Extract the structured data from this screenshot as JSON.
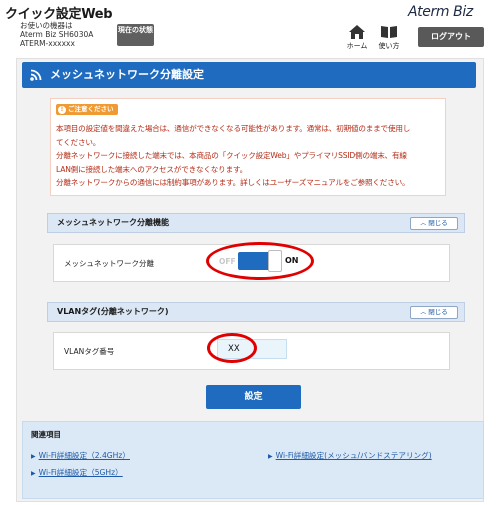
{
  "header": {
    "app_title": "クイック設定Web",
    "device_label": "お使いの機器は",
    "device_model": "Aterm Biz SH6030A",
    "device_name": "ATERM-xxxxxx",
    "status_button": "現在の状態",
    "brand": "Aterm Biz",
    "nav_home": "ホーム",
    "nav_help": "使い方",
    "logout_button": "ログアウト"
  },
  "page": {
    "title": "メッシュネットワーク分離設定"
  },
  "caution": {
    "badge": "ご注意ください",
    "lines": [
      "本項目の設定値を間違えた場合は、通信ができなくなる可能性があります。通常は、初期値のままで使用し",
      "てください。",
      "分離ネットワークに接続した端末では、本商品の「クイック設定Web」やプライマリSSID側の端末、有線",
      "LAN側に接続した端末へのアクセスができなくなります。",
      "分離ネットワークからの通信には制約事項があります。詳しくはユーザーズマニュアルをご参照ください。"
    ]
  },
  "section_isolation": {
    "header": "メッシュネットワーク分離機能",
    "close_button": "閉じる",
    "row_label": "メッシュネットワーク分離",
    "toggle_off_label": "OFF",
    "toggle_on_label": "ON",
    "toggle_state": "ON"
  },
  "section_vlan": {
    "header": "VLANタグ(分離ネットワーク)",
    "close_button": "閉じる",
    "row_label": "VLANタグ番号",
    "vlan_value": "XX"
  },
  "set_button": "設定",
  "related": {
    "title": "関連項目",
    "links": [
      "Wi-Fi詳細設定（2.4GHz）",
      "Wi-Fi詳細設定（5GHz）",
      "Wi-Fi詳細設定(メッシュ/バンドステアリング)"
    ]
  },
  "colors": {
    "accent_blue": "#1e6bbf",
    "caution_text": "#b52c17",
    "caution_badge": "#f09a33",
    "annotation_red": "#e00000"
  }
}
